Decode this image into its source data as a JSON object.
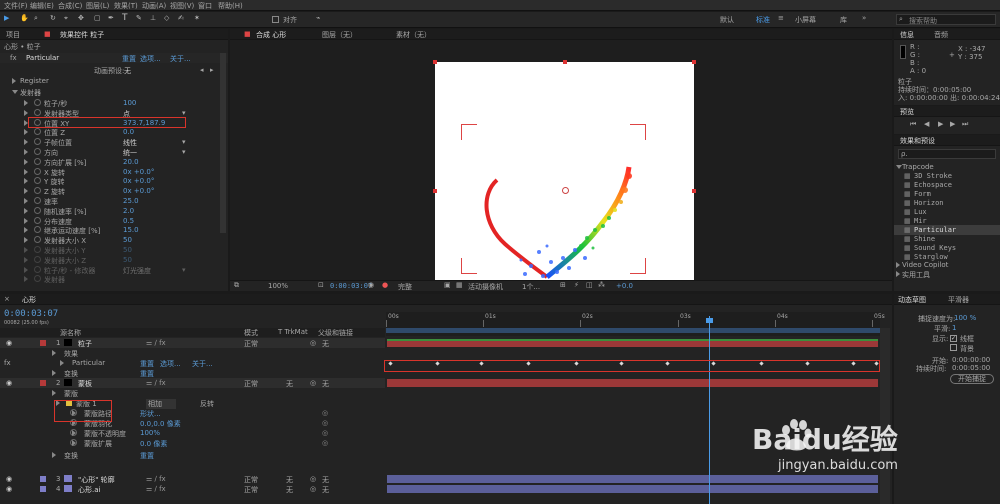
{
  "menubar": {
    "items": [
      "文件(F)",
      "编辑(E)",
      "合成(C)",
      "图层(L)",
      "效果(T)",
      "动画(A)",
      "视图(V)",
      "窗口",
      "帮助(H)"
    ]
  },
  "toolbar": {
    "snap_label": "对齐",
    "workspaces": [
      "默认",
      "标准",
      "小屏幕",
      "库"
    ],
    "search_placeholder": "搜索帮助"
  },
  "effect_controls": {
    "tab_project": "项目",
    "tab_label": "效果控件 粒子",
    "breadcrumb": "心形 • 粒子",
    "effect_name": "Particular",
    "effect_links": [
      "重置",
      "选项...",
      "关于..."
    ],
    "preset_label": "动画预设:",
    "preset_value": "无",
    "register_label": "Register",
    "emitter_label": "发射器",
    "props": [
      {
        "name": "粒子/秒",
        "value": "100"
      },
      {
        "name": "发射器类型",
        "value": "点"
      },
      {
        "name": "位置 XY",
        "value": "373.7,187.9"
      },
      {
        "name": "位置 Z",
        "value": "0.0"
      },
      {
        "name": "子帧位置",
        "value": "线性"
      },
      {
        "name": "方向",
        "value": "统一"
      },
      {
        "name": "方向扩展 [%]",
        "value": "20.0"
      },
      {
        "name": "X 旋转",
        "value": "0x +0.0°"
      },
      {
        "name": "Y 旋转",
        "value": "0x +0.0°"
      },
      {
        "name": "Z 旋转",
        "value": "0x +0.0°"
      },
      {
        "name": "速率",
        "value": "25.0"
      },
      {
        "name": "随机速率 [%]",
        "value": "2.0"
      },
      {
        "name": "分布速度",
        "value": "0.5"
      },
      {
        "name": "继承运动速度 [%]",
        "value": "15.0"
      },
      {
        "name": "发射器大小 X",
        "value": "50"
      },
      {
        "name": "发射器大小 Y",
        "value": "50"
      },
      {
        "name": "发射器大小 Z",
        "value": "50"
      },
      {
        "name": "粒子/秒 - 修改器",
        "value": "灯光强度"
      },
      {
        "name": "发射器",
        "value": ""
      }
    ]
  },
  "composition": {
    "tab_label": "合成 心形",
    "layer_tab": "图层（无）",
    "footage_tab": "素材（无）",
    "zoom": "100%",
    "timecode": "0:00:03:07",
    "quality": "完整",
    "camera": "活动摄像机",
    "views": "1个...",
    "exposure": "+0.0"
  },
  "info_panel": {
    "tab_info": "信息",
    "tab_audio": "音频",
    "r_label": "R :",
    "g_label": "G :",
    "b_label": "B :",
    "a_label": "A : 0",
    "x_coord": "X : -347",
    "y_coord": "Y : 375",
    "layer_name": "粒子",
    "duration": "持续时间：0:00:05:00",
    "in_out": "入: 0:00:00:00 出: 0:00:04:24"
  },
  "preview_panel": {
    "title": "预览"
  },
  "effects_presets": {
    "title": "效果和预设",
    "search_placeholder": "ρ.",
    "group": "Trapcode",
    "items": [
      "3D Stroke",
      "Echospace",
      "Form",
      "Horizon",
      "Lux",
      "Mir",
      "Particular",
      "Shine",
      "Sound Keys",
      "Starglow"
    ],
    "more_groups": [
      "Video Copilot",
      "实用工具"
    ]
  },
  "smoother": {
    "tab_smoother": "动态草图",
    "tab_wiggler": "平滑器",
    "speed_label": "捕捉速度为:",
    "speed_value": "100 %",
    "smoothing_label": "平滑:",
    "smoothing_value": "1",
    "display_label": "显示:",
    "wireframe": "线框",
    "background": "背景",
    "start_label": "开始:",
    "start_value": "0:00:00:00",
    "duration_label": "持续时间:",
    "duration_value": "0:00:05:00",
    "capture_button": "开始捕捉"
  },
  "timeline": {
    "tab_label": "心形",
    "timecode": "0:00:03:07",
    "timecode_sub": "00082 (25.00 fps)",
    "columns": {
      "source": "源名称",
      "mode": "模式",
      "trkmat": "T TrkMat",
      "parent": "父级和链接"
    },
    "ruler": [
      "00s",
      "01s",
      "02s",
      "03s",
      "04s",
      "05s"
    ],
    "layers": [
      {
        "num": "1",
        "name": "粒子",
        "mode": "正常",
        "trk": "",
        "parent": "无",
        "color": "#b53a3a"
      },
      {
        "num": "2",
        "name": "蒙板",
        "mode": "正常",
        "trk": "无",
        "parent": "无",
        "color": "#b53a3a"
      },
      {
        "num": "3",
        "name": "\"心形\" 轮廓",
        "mode": "正常",
        "trk": "无",
        "parent": "无",
        "color": "#7e7ec8"
      },
      {
        "num": "4",
        "name": "心形.ai",
        "mode": "正常",
        "trk": "无",
        "parent": "无",
        "color": "#7e7ec8"
      }
    ],
    "sub": {
      "effects": "效果",
      "particular": "Particular",
      "transform": "变换",
      "masks": "蒙版",
      "mask1": "蒙版 1",
      "mask_mode": "相加",
      "invert": "反转",
      "mask_path": "蒙版路径",
      "mask_path_value": "形状...",
      "mask_feather": "蒙版羽化",
      "mask_feather_value": "0.0,0.0 像素",
      "mask_opacity": "蒙版不透明度",
      "mask_opacity_value": "100%",
      "mask_expansion": "蒙版扩展",
      "mask_expansion_value": "0.0 像素",
      "transform2": "变换",
      "reset": "重置",
      "reset2": "重置"
    }
  },
  "watermark": {
    "brand": "Baidu经验",
    "url": "jingyan.baidu.com"
  }
}
